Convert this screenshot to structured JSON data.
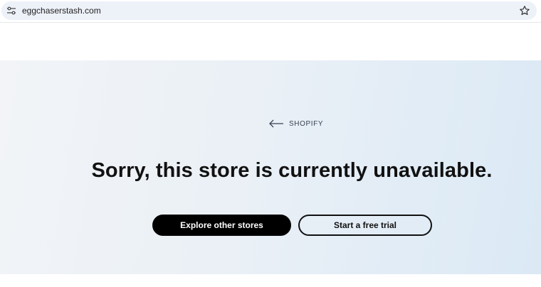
{
  "browser": {
    "url": "eggchaserstash.com",
    "site_info_icon": "tune-icon",
    "bookmark_icon": "star-outline-icon"
  },
  "page": {
    "back_link": {
      "icon": "arrow-left-icon",
      "label": "SHOPIFY"
    },
    "headline": "Sorry, this store is currently unavailable.",
    "primary_button": "Explore other stores",
    "secondary_button": "Start a free trial"
  },
  "colors": {
    "hero_gradient_start": "#f2f4f7",
    "hero_gradient_end": "#dbe9f5",
    "primary_button_bg": "#000000",
    "primary_button_text": "#ffffff",
    "text": "#111111"
  }
}
